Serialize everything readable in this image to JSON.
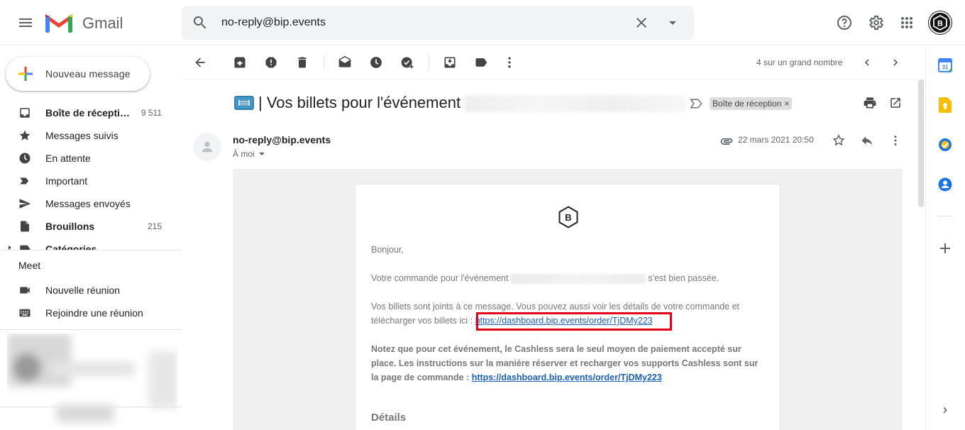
{
  "app": {
    "name": "Gmail"
  },
  "search": {
    "value": "no-reply@bip.events"
  },
  "compose": {
    "label": "Nouveau message"
  },
  "nav": [
    {
      "label": "Boîte de réception",
      "count": "9 511",
      "bold": true
    },
    {
      "label": "Messages suivis",
      "count": ""
    },
    {
      "label": "En attente",
      "count": ""
    },
    {
      "label": "Important",
      "count": ""
    },
    {
      "label": "Messages envoyés",
      "count": ""
    },
    {
      "label": "Brouillons",
      "count": "215",
      "bold": true
    },
    {
      "label": "Catégories",
      "count": "",
      "bold": true
    }
  ],
  "meet": {
    "title": "Meet",
    "new_meeting": "Nouvelle réunion",
    "join_meeting": "Rejoindre une réunion"
  },
  "toolbar": {
    "pager": "4 sur un grand nombre"
  },
  "message": {
    "subject": "| Vos billets pour l'événement",
    "label": "Boîte de réception",
    "label_close": "×",
    "sender": "no-reply@bip.events",
    "recipient": "À moi",
    "date": "22 mars 2021 20:50"
  },
  "email_body": {
    "greeting": "Bonjour,",
    "order_line_start": "Votre commande pour l'événement",
    "order_line_end": "s'est bien passée.",
    "tickets_text": "Vos billets sont joints à ce message. Vous pouvez aussi voir les détails de votre commande et télécharger vos billets ici :",
    "order_link": "https://dashboard.bip.events/order/TjDMy223",
    "cashless_text": "Notez que pour cet événement, le Cashless sera le seul moyen de paiement accepté sur place. Les instructions sur la manière réserver et recharger vos supports Cashless sont sur la page de commande :",
    "cashless_link": "https://dashboard.bip.events/order/TjDMy223",
    "details_heading": "Détails"
  },
  "avatar_letter": "B",
  "colors": {
    "highlight_box": "#e3001b",
    "link": "#1a5fb4",
    "accent_red": "#ea4335"
  }
}
